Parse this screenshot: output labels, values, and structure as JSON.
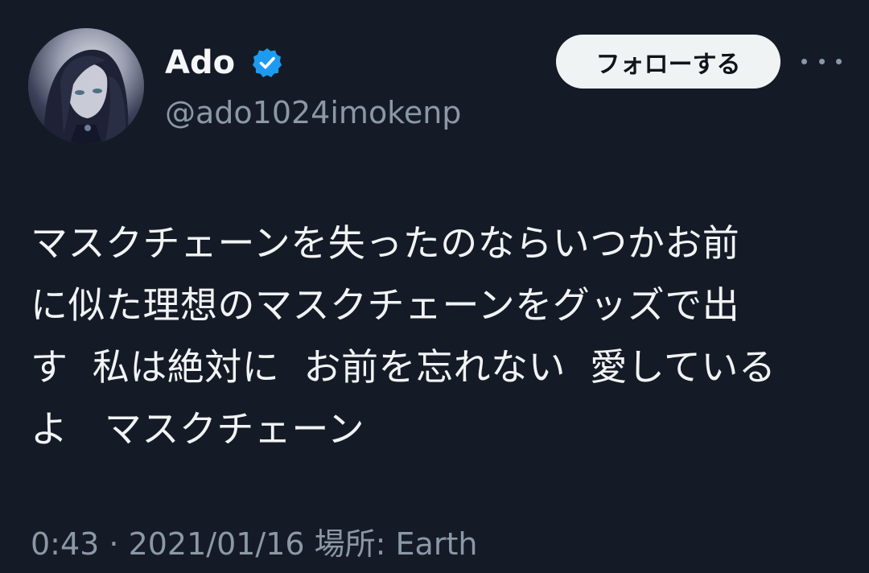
{
  "author": {
    "display_name": "Ado",
    "handle": "@ado1024imokenp",
    "verified": true
  },
  "actions": {
    "follow_label": "フォローする"
  },
  "tweet": {
    "lines": [
      "マスクチェーンを失ったのならいつかお前",
      "に似た理想のマスクチェーンをグッズで出",
      "す  私は絶対に  お前を忘れない  愛している",
      "よ   マスクチェーン"
    ]
  },
  "meta": {
    "line": "0:43 · 2021/01/16 場所: Earth"
  },
  "colors": {
    "background": "#151b26",
    "verified_badge": "#1d9bf0",
    "secondary_text": "#8b98a5",
    "follow_button_bg": "#eff3f4"
  },
  "icons": {
    "verified": "verified-badge-icon",
    "more": "more-horizontal-icon"
  }
}
